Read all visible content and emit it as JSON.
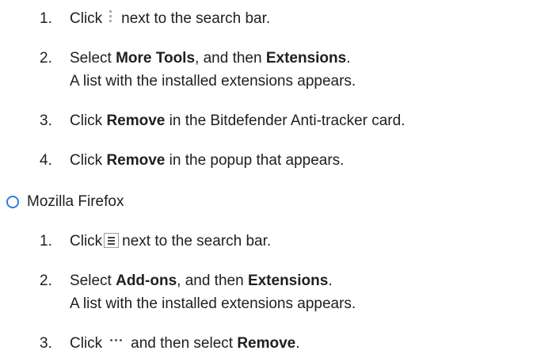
{
  "chrome_steps": [
    {
      "number": "1.",
      "before": "Click",
      "after": "next to the search bar."
    },
    {
      "number": "2.",
      "select": "Select ",
      "bold1": "More Tools",
      "mid": ", and then ",
      "bold2": "Extensions",
      "end": ".",
      "second_line": "A list with the installed extensions appears."
    },
    {
      "number": "3.",
      "before": "Click ",
      "bold": "Remove",
      "after": " in the Bitdefender Anti-tracker card."
    },
    {
      "number": "4.",
      "before": "Click ",
      "bold": "Remove",
      "after": " in the popup that appears."
    }
  ],
  "firefox": {
    "heading": "Mozilla Firefox",
    "bullet_color": "#2d7fd6",
    "steps": [
      {
        "number": "1.",
        "before": "Click",
        "after": "next to the search bar."
      },
      {
        "number": "2.",
        "select": "Select ",
        "bold1": "Add-ons",
        "mid": ", and then ",
        "bold2": "Extensions",
        "end": ".",
        "second_line": "A list with the installed extensions appears."
      },
      {
        "number": "3.",
        "before": "Click",
        "mid": "and then select ",
        "bold": "Remove",
        "end": "."
      }
    ]
  },
  "icons": {
    "chrome_menu": "vertical-ellipsis-icon",
    "firefox_menu": "hamburger-menu-icon",
    "more_options": "horizontal-ellipsis-icon"
  }
}
